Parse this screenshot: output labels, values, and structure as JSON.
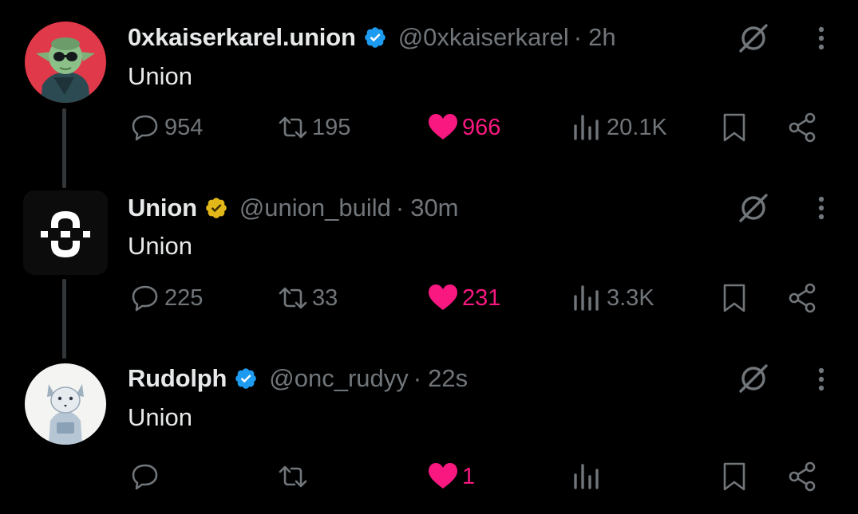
{
  "tweets": [
    {
      "name": "0xkaiserkarel.union",
      "handle": "@0xkaiserkarel",
      "separator": "·",
      "time": "2h",
      "verified": "blue",
      "text": "Union",
      "replies": "954",
      "retweets": "195",
      "likes": "966",
      "liked": true,
      "views": "20.1K"
    },
    {
      "name": "Union",
      "handle": "@union_build",
      "separator": "·",
      "time": "30m",
      "verified": "gold",
      "text": "Union",
      "replies": "225",
      "retweets": "33",
      "likes": "231",
      "liked": true,
      "views": "3.3K"
    },
    {
      "name": "Rudolph",
      "handle": "@onc_rudyy",
      "separator": "·",
      "time": "22s",
      "verified": "blue",
      "text": "Union",
      "replies": "",
      "retweets": "",
      "likes": "1",
      "liked": true,
      "views": ""
    }
  ],
  "colors": {
    "background": "#000000",
    "text": "#e7e9ea",
    "muted": "#71767b",
    "like": "#f91880",
    "verified_blue": "#1d9bf0",
    "verified_gold": "#e2b719"
  },
  "icons": [
    "reply-icon",
    "retweet-icon",
    "like-icon",
    "views-icon",
    "bookmark-icon",
    "share-icon",
    "grok-icon",
    "more-icon",
    "verified-badge-icon"
  ]
}
